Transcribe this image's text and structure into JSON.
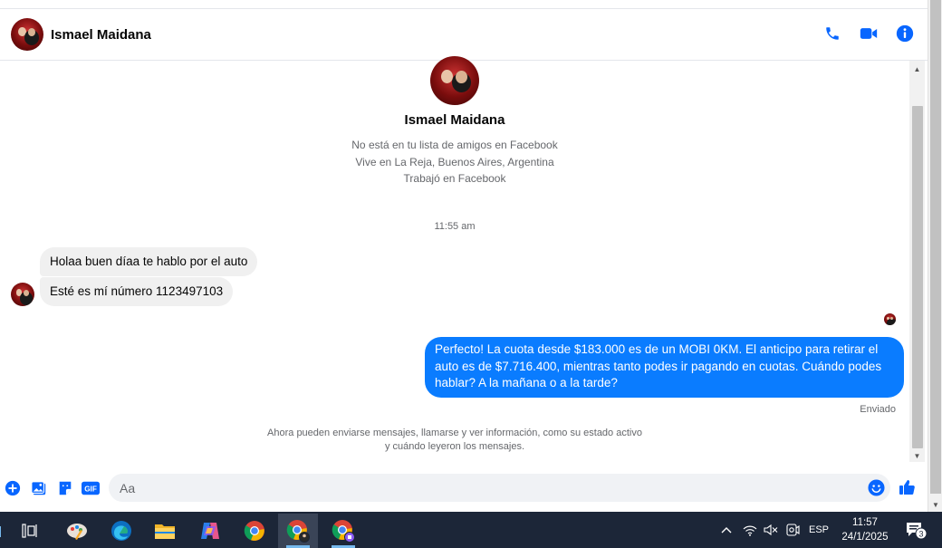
{
  "contact": {
    "name": "Ismael Maidana",
    "info": [
      "No está en tu lista de amigos en Facebook",
      "Vive en La Reja, Buenos Aires, Argentina",
      "Trabajó en Facebook"
    ]
  },
  "header": {
    "actions": [
      "phone-icon",
      "video-icon",
      "info-icon"
    ]
  },
  "chat": {
    "timestamp": "11:55 am",
    "incoming": [
      "Holaa buen díaa te hablo por el auto",
      "Esté es mí número 1123497103"
    ],
    "outgoing": "Perfecto! La cuota desde $183.000 es de un MOBI 0KM. El anticipo para retirar el auto es de $7.716.400, mientras tanto podes ir pagando en cuotas. Cuándo podes hablar? A la mañana o a la tarde?",
    "sent_status": "Enviado",
    "notice_line1": "Ahora pueden enviarse mensajes, llamarse y ver información, como su estado activo",
    "notice_line2": "y cuándo leyeron los mensajes."
  },
  "composer": {
    "placeholder": "Aa",
    "gif_label": "GIF"
  },
  "colors": {
    "accent": "#0a7cff",
    "header_icon": "#0866ff",
    "taskbar": "#1c2638"
  },
  "taskbar": {
    "language": "ESP",
    "time": "11:57",
    "date": "24/1/2025",
    "notification_count": "3"
  }
}
